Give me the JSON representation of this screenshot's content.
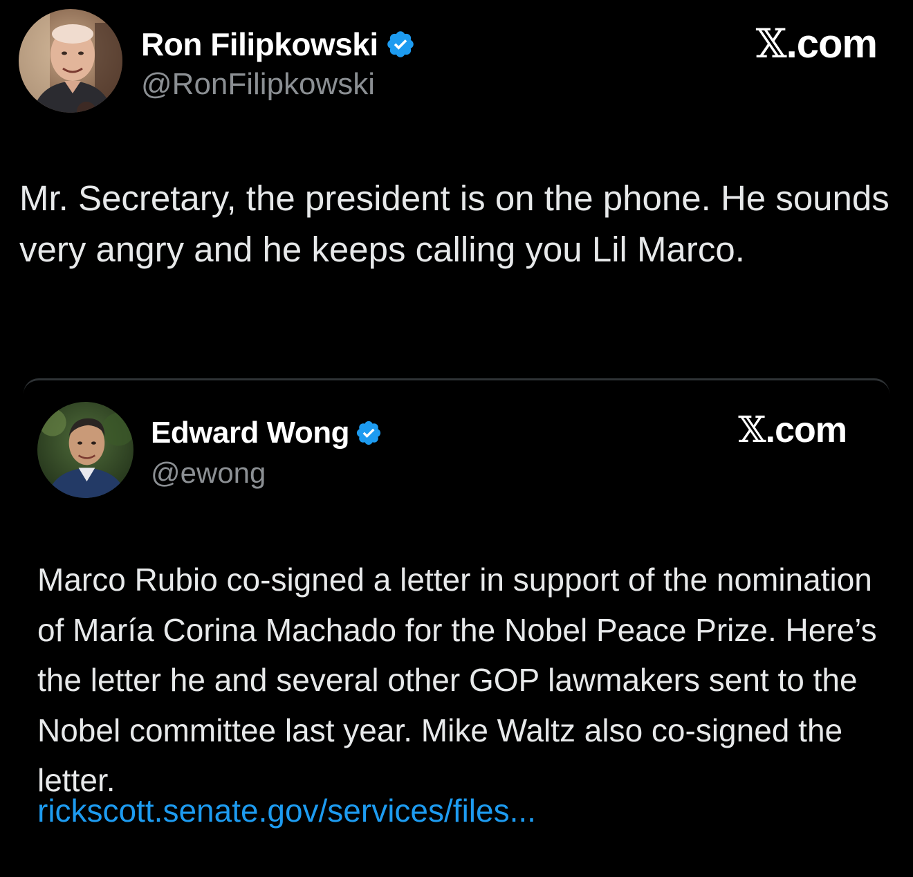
{
  "main_tweet": {
    "author": {
      "display_name": "Ron Filipkowski",
      "handle": "@RonFilipkowski",
      "verified": true
    },
    "brand": {
      "x_glyph": "𝕏",
      "suffix": ".com"
    },
    "text": "Mr. Secretary, the president is on the phone. He sounds very angry and he keeps calling you Lil Marco."
  },
  "quoted_tweet": {
    "author": {
      "display_name": "Edward Wong",
      "handle": "@ewong",
      "verified": true
    },
    "brand": {
      "x_glyph": "𝕏",
      "suffix": ".com"
    },
    "text": "Marco Rubio co-signed a letter in support of the nomination of María Corina Machado for the Nobel Peace Prize. Here’s the letter he and several other GOP lawmakers sent to the Nobel committee last year. Mike Waltz also co-signed the letter.",
    "link_text": "rickscott.senate.gov/services/files..."
  },
  "icons": {
    "verified": "verified-badge-icon",
    "brand": "x-logo-icon"
  },
  "colors": {
    "background": "#000000",
    "text": "#e7e9ea",
    "secondary_text": "#8b8f93",
    "link": "#1d9bf0",
    "verified_badge": "#1d9bf0",
    "card_border": "#2f3336"
  }
}
